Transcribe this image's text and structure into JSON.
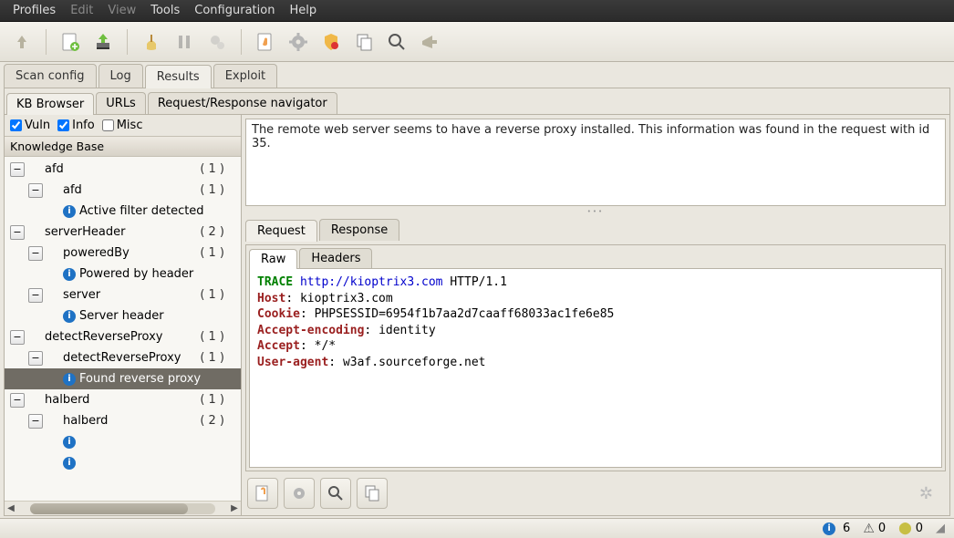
{
  "menu": {
    "profiles": "Profiles",
    "edit": "Edit",
    "view": "View",
    "tools": "Tools",
    "configuration": "Configuration",
    "help": "Help"
  },
  "main_tabs": {
    "scan_config": "Scan config",
    "log": "Log",
    "results": "Results",
    "exploit": "Exploit"
  },
  "sub_tabs": {
    "kb_browser": "KB Browser",
    "urls": "URLs",
    "rr_nav": "Request/Response navigator"
  },
  "filters": {
    "vuln": "Vuln",
    "info": "Info",
    "misc": "Misc"
  },
  "kb_header": "Knowledge Base",
  "tree": {
    "afd": {
      "label": "afd",
      "count": "( 1 )"
    },
    "afd_child": {
      "label": "afd",
      "count": "( 1 )"
    },
    "afd_leaf": "Active filter detected",
    "serverHeader": {
      "label": "serverHeader",
      "count": "( 2 )"
    },
    "poweredBy": {
      "label": "poweredBy",
      "count": "( 1 )"
    },
    "poweredBy_leaf": "Powered by header",
    "server": {
      "label": "server",
      "count": "( 1 )"
    },
    "server_leaf": "Server header",
    "detectReverseProxy": {
      "label": "detectReverseProxy",
      "count": "( 1 )"
    },
    "detectReverseProxy_child": {
      "label": "detectReverseProxy",
      "count": "( 1 )"
    },
    "drp_leaf": "Found reverse proxy",
    "halberd": {
      "label": "halberd",
      "count": "( 1 )"
    },
    "halberd_child": {
      "label": "halberd",
      "count": "( 2 )"
    }
  },
  "description": "The remote web server seems to have a reverse proxy installed. This information was found in the request with id 35.",
  "reqres_tabs": {
    "request": "Request",
    "response": "Response"
  },
  "rawhdr_tabs": {
    "raw": "Raw",
    "headers": "Headers"
  },
  "http": {
    "method": "TRACE",
    "url": "http://kioptrix3.com",
    "protocol": "HTTP/1.1",
    "headers": {
      "Host": "kioptrix3.com",
      "Cookie": "PHPSESSID=6954f1b7aa2d7caaff68033ac1fe6e85",
      "Accept-encoding": "identity",
      "Accept": "*/*",
      "User-agent": "w3af.sourceforge.net"
    }
  },
  "status": {
    "info": "6",
    "warn": "0",
    "shell": "0"
  }
}
